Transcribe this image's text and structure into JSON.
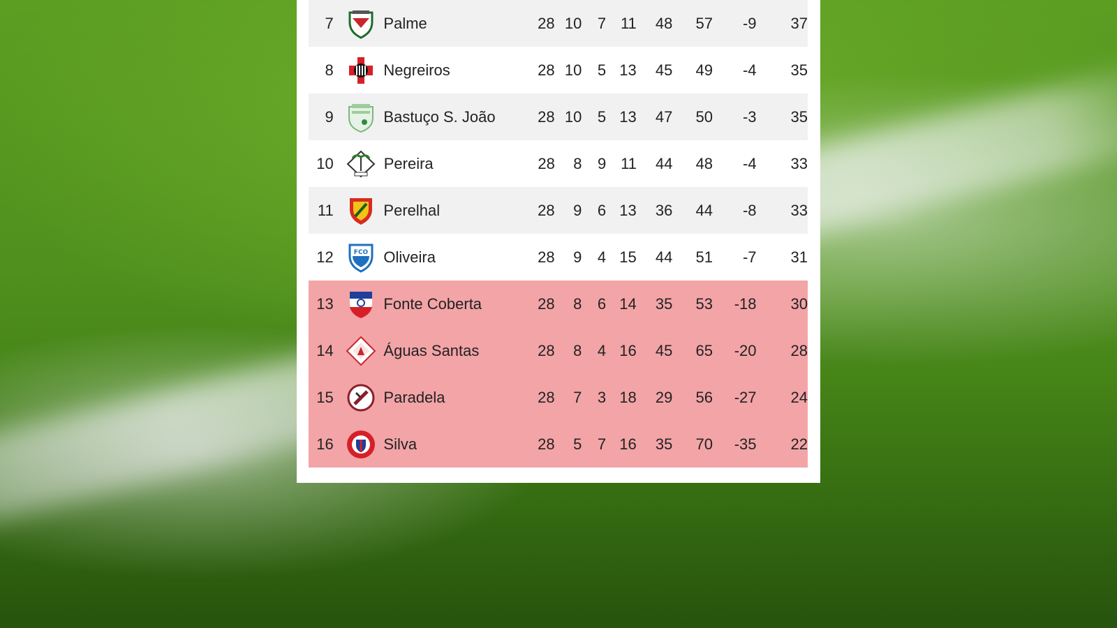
{
  "standings": {
    "rows": [
      {
        "pos": "7",
        "team": "Palme",
        "j": "28",
        "v": "10",
        "e": "7",
        "d": "11",
        "gm": "48",
        "gs": "57",
        "dg": "-9",
        "pts": "37",
        "zone": "normal",
        "crest": "shield-green-red-icon"
      },
      {
        "pos": "8",
        "team": "Negreiros",
        "j": "28",
        "v": "10",
        "e": "5",
        "d": "13",
        "gm": "45",
        "gs": "49",
        "dg": "-4",
        "pts": "35",
        "zone": "normal",
        "crest": "cross-red-black-icon"
      },
      {
        "pos": "9",
        "team": "Bastuço S. João",
        "j": "28",
        "v": "10",
        "e": "5",
        "d": "13",
        "gm": "47",
        "gs": "50",
        "dg": "-3",
        "pts": "35",
        "zone": "normal",
        "crest": "shield-pale-green-icon"
      },
      {
        "pos": "10",
        "team": "Pereira",
        "j": "28",
        "v": "8",
        "e": "9",
        "d": "11",
        "gm": "44",
        "gs": "48",
        "dg": "-4",
        "pts": "33",
        "zone": "normal",
        "crest": "palm-diamond-icon"
      },
      {
        "pos": "11",
        "team": "Perelhal",
        "j": "28",
        "v": "9",
        "e": "6",
        "d": "13",
        "gm": "36",
        "gs": "44",
        "dg": "-8",
        "pts": "33",
        "zone": "normal",
        "crest": "shield-yellow-red-icon"
      },
      {
        "pos": "12",
        "team": "Oliveira",
        "j": "28",
        "v": "9",
        "e": "4",
        "d": "15",
        "gm": "44",
        "gs": "51",
        "dg": "-7",
        "pts": "31",
        "zone": "normal",
        "crest": "shield-blue-icon"
      },
      {
        "pos": "13",
        "team": "Fonte Coberta",
        "j": "28",
        "v": "8",
        "e": "6",
        "d": "14",
        "gm": "35",
        "gs": "53",
        "dg": "-18",
        "pts": "30",
        "zone": "relegation",
        "crest": "shield-blue-red-icon"
      },
      {
        "pos": "14",
        "team": "Águas Santas",
        "j": "28",
        "v": "8",
        "e": "4",
        "d": "16",
        "gm": "45",
        "gs": "65",
        "dg": "-20",
        "pts": "28",
        "zone": "relegation",
        "crest": "diamond-red-icon"
      },
      {
        "pos": "15",
        "team": "Paradela",
        "j": "28",
        "v": "7",
        "e": "3",
        "d": "18",
        "gm": "29",
        "gs": "56",
        "dg": "-27",
        "pts": "24",
        "zone": "relegation",
        "crest": "round-maroon-icon"
      },
      {
        "pos": "16",
        "team": "Silva",
        "j": "28",
        "v": "5",
        "e": "7",
        "d": "16",
        "gm": "35",
        "gs": "70",
        "dg": "-35",
        "pts": "22",
        "zone": "relegation",
        "crest": "round-red-blue-icon"
      }
    ]
  },
  "colors": {
    "relegation_row": "#f3a4a7",
    "alt_row": "#f1f1f1",
    "panel": "#ffffff",
    "grass": "#4f8f1d"
  }
}
